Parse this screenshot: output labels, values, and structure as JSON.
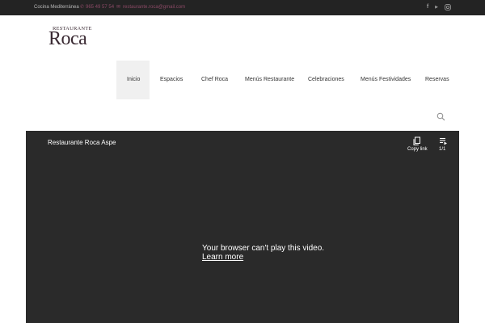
{
  "topbar": {
    "tagline": "Cocina Mediterránea",
    "phone": "965 49 57 54",
    "email": "restaurante.roca@gmail.com",
    "icons": {
      "phone": "phone-icon",
      "email": "envelope-icon"
    },
    "social": [
      "facebook-icon",
      "youtube-icon",
      "instagram-icon"
    ]
  },
  "logo": {
    "small_text": "RESTAURANTE",
    "big_text": "Roca"
  },
  "nav": {
    "items": [
      "Inicio",
      "Espacios",
      "Chef Roca",
      "Menús Restaurante",
      "Celebraciones",
      "Menús Festividades",
      "Reservas"
    ],
    "active": "Inicio",
    "search_icon": "search-icon"
  },
  "video": {
    "title": "Restaurante Roca Aspe",
    "copy_link": "Copy link",
    "playlist_count": "1/1",
    "message": "Your browser can't play this video.",
    "learn_more": "Learn more"
  },
  "colors": {
    "topbar_bg": "#232323",
    "accent": "#8c4a66",
    "video_bg": "#2a2a2a",
    "nav_active_bg": "#f0f0f0"
  }
}
